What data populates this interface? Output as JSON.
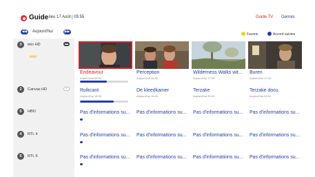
{
  "header": {
    "app_title": "Guide",
    "datetime": "lieu 17 Août | 05:55",
    "nav": {
      "guide_tv": "Guide TV",
      "genres": "Genres"
    }
  },
  "day_selector": {
    "prev": "◀◀",
    "label": "Aujourd'hui",
    "next": "▶▶"
  },
  "legend": {
    "favorites": "Favoris",
    "recordings": "Accord suivies"
  },
  "channels": [
    {
      "num": "3",
      "name": "één HD",
      "toggle": "▬"
    },
    {
      "num": "2",
      "name": "Canvas HD",
      "toggle": "▬"
    },
    {
      "num": "5",
      "name": "HBO"
    },
    {
      "num": "4",
      "name": "RTL 4"
    },
    {
      "num": "5",
      "name": "RTL 5"
    }
  ],
  "channel_logo_text": "eén",
  "programs": {
    "row1": [
      {
        "title": "Endeavour",
        "time": "Aujourd'hui 05:30",
        "progress": 0.55
      },
      {
        "title": "Perception",
        "time": "Aujourd'hui 06:30"
      },
      {
        "title": "Wilderness Walks wit...",
        "time": "Aujourd'hui 17:45"
      },
      {
        "title": "Buren",
        "time": "Aujourd'hui 17:45"
      }
    ],
    "row2": [
      {
        "title": "Rolkcant",
        "time": "Aujourd'hui 18:30",
        "progress": 0.7
      },
      {
        "title": "De kleedkamer",
        "time": "Aujourd'hui 19:00"
      },
      {
        "title": "Terzake",
        "time": "Aujourd'hui 20:00"
      },
      {
        "title": "Terzake docu",
        "time": "Aujourd'hui 20:20"
      }
    ],
    "no_info_label": "Pas d'informations su..."
  },
  "colors": {
    "accent": "#1f3ea8",
    "brand_red": "#d42027",
    "sidebar": "#f1f1f1"
  }
}
